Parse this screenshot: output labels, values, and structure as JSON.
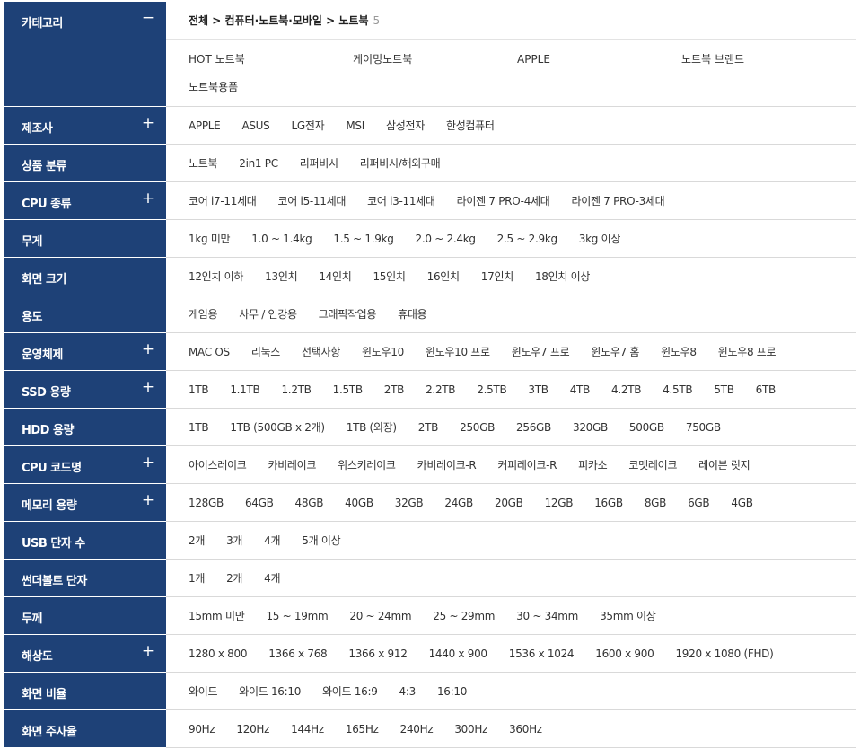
{
  "category": {
    "label": "카테고리",
    "toggle": "−",
    "breadcrumb": "전체 > 컴퓨터·노트북·모바일 > 노트북",
    "count": "5",
    "items": [
      "HOT 노트북",
      "게이밍노트북",
      "APPLE",
      "노트북 브랜드",
      "노트북용품"
    ]
  },
  "filters": [
    {
      "label": "제조사",
      "toggle": "+",
      "values": [
        "APPLE",
        "ASUS",
        "LG전자",
        "MSI",
        "삼성전자",
        "한성컴퓨터"
      ]
    },
    {
      "label": "상품 분류",
      "toggle": "",
      "values": [
        "노트북",
        "2in1 PC",
        "리퍼비시",
        "리퍼비시/해외구매"
      ]
    },
    {
      "label": "CPU 종류",
      "toggle": "+",
      "values": [
        "코어 i7-11세대",
        "코어 i5-11세대",
        "코어 i3-11세대",
        "라이젠 7 PRO-4세대",
        "라이젠 7 PRO-3세대"
      ]
    },
    {
      "label": "무게",
      "toggle": "",
      "values": [
        "1kg 미만",
        "1.0 ~ 1.4kg",
        "1.5 ~ 1.9kg",
        "2.0 ~ 2.4kg",
        "2.5 ~ 2.9kg",
        "3kg 이상"
      ]
    },
    {
      "label": "화면 크기",
      "toggle": "",
      "values": [
        "12인치 이하",
        "13인치",
        "14인치",
        "15인치",
        "16인치",
        "17인치",
        "18인치 이상"
      ]
    },
    {
      "label": "용도",
      "toggle": "",
      "values": [
        "게임용",
        "사무 / 인강용",
        "그래픽작업용",
        "휴대용"
      ]
    },
    {
      "label": "운영체제",
      "toggle": "+",
      "values": [
        "MAC OS",
        "리눅스",
        "선택사항",
        "윈도우10",
        "윈도우10 프로",
        "윈도우7 프로",
        "윈도우7 홈",
        "윈도우8",
        "윈도우8 프로"
      ]
    },
    {
      "label": "SSD 용량",
      "toggle": "+",
      "values": [
        "1TB",
        "1.1TB",
        "1.2TB",
        "1.5TB",
        "2TB",
        "2.2TB",
        "2.5TB",
        "3TB",
        "4TB",
        "4.2TB",
        "4.5TB",
        "5TB",
        "6TB"
      ]
    },
    {
      "label": "HDD 용량",
      "toggle": "",
      "values": [
        "1TB",
        "1TB (500GB x 2개)",
        "1TB (외장)",
        "2TB",
        "250GB",
        "256GB",
        "320GB",
        "500GB",
        "750GB"
      ]
    },
    {
      "label": "CPU 코드명",
      "toggle": "+",
      "values": [
        "아이스레이크",
        "카비레이크",
        "위스키레이크",
        "카비레이크-R",
        "커피레이크-R",
        "피카소",
        "코멧레이크",
        "레이븐 릿지"
      ]
    },
    {
      "label": "메모리 용량",
      "toggle": "+",
      "values": [
        "128GB",
        "64GB",
        "48GB",
        "40GB",
        "32GB",
        "24GB",
        "20GB",
        "12GB",
        "16GB",
        "8GB",
        "6GB",
        "4GB"
      ]
    },
    {
      "label": "USB 단자 수",
      "toggle": "",
      "values": [
        "2개",
        "3개",
        "4개",
        "5개 이상"
      ]
    },
    {
      "label": "썬더볼트 단자",
      "toggle": "",
      "values": [
        "1개",
        "2개",
        "4개"
      ]
    },
    {
      "label": "두께",
      "toggle": "",
      "values": [
        "15mm 미만",
        "15 ~ 19mm",
        "20 ~ 24mm",
        "25 ~ 29mm",
        "30 ~ 34mm",
        "35mm 이상"
      ]
    },
    {
      "label": "해상도",
      "toggle": "+",
      "values": [
        "1280 x 800",
        "1366 x 768",
        "1366 x 912",
        "1440 x 900",
        "1536 x 1024",
        "1600 x 900",
        "1920 x 1080 (FHD)"
      ]
    },
    {
      "label": "화면 비율",
      "toggle": "",
      "values": [
        "와이드",
        "와이드 16:10",
        "와이드 16:9",
        "4:3",
        "16:10"
      ]
    },
    {
      "label": "화면 주사율",
      "toggle": "",
      "values": [
        "90Hz",
        "120Hz",
        "144Hz",
        "165Hz",
        "240Hz",
        "300Hz",
        "360Hz"
      ]
    }
  ]
}
